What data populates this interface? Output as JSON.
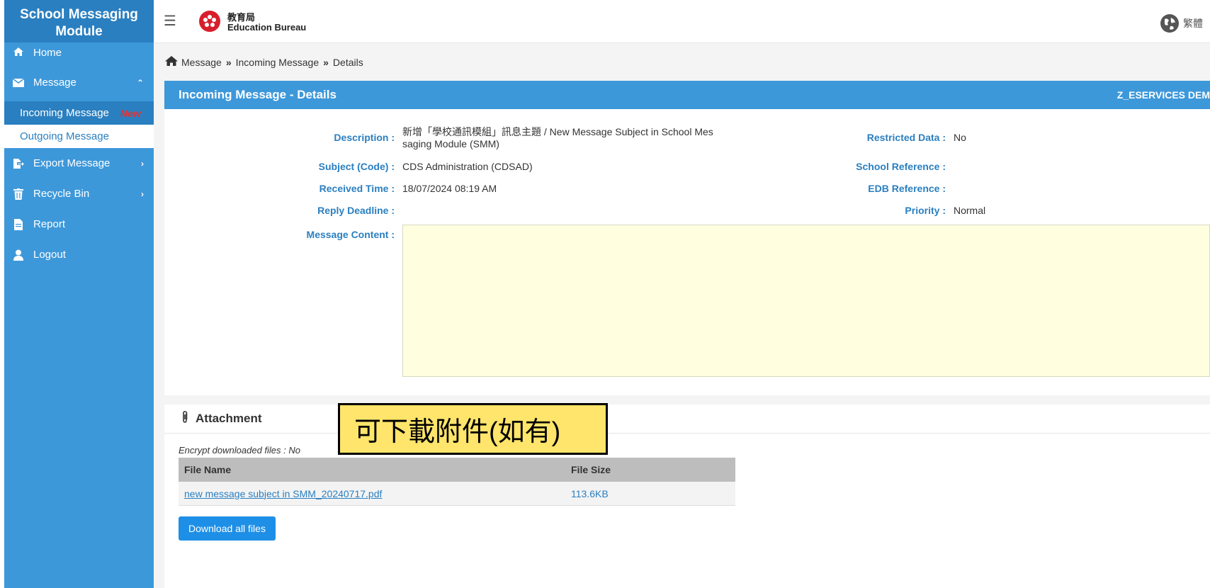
{
  "sidebar": {
    "title_line1": "School Messaging",
    "title_line2": "Module",
    "items": [
      {
        "label": "Home",
        "icon": "home-icon"
      },
      {
        "label": "Message",
        "icon": "envelope-icon"
      },
      {
        "label": "Export Message",
        "icon": "export-icon"
      },
      {
        "label": "Recycle Bin",
        "icon": "trash-icon"
      },
      {
        "label": "Report",
        "icon": "document-icon"
      },
      {
        "label": "Logout",
        "icon": "user-icon"
      }
    ],
    "sub_items": [
      {
        "label": "Incoming Message",
        "badge": "New"
      },
      {
        "label": "Outgoing Message"
      }
    ]
  },
  "topbar": {
    "logo_cn": "教育局",
    "logo_en": "Education Bureau",
    "lang_label": "繁體"
  },
  "breadcrumb": [
    "Message",
    "Incoming Message",
    "Details"
  ],
  "panel": {
    "title": "Incoming Message - Details",
    "right_text": "Z_ESERVICES DEM",
    "fields": {
      "description_label": "Description :",
      "description_line1": "新增「學校通訊模組」訊息主題 / New Message Subject in School Mes",
      "description_line2": "saging Module (SMM)",
      "subject_label": "Subject (Code) :",
      "subject_value": "CDS Administration (CDSAD)",
      "received_label": "Received Time :",
      "received_value": "18/07/2024 08:19 AM",
      "deadline_label": "Reply Deadline :",
      "content_label": "Message Content :",
      "restricted_label": "Restricted Data :",
      "restricted_value": "No",
      "school_ref_label": "School Reference :",
      "edb_ref_label": "EDB Reference :",
      "priority_label": "Priority :",
      "priority_value": "Normal"
    }
  },
  "attachment": {
    "title": "Attachment",
    "encrypt_text": "Encrypt downloaded files : No",
    "columns": [
      "File Name",
      "File Size"
    ],
    "files": [
      {
        "name": "new message subject in SMM_20240717.pdf",
        "size": "113.6KB"
      }
    ],
    "download_label": "Download all files"
  },
  "callout_text": "可下載附件(如有)",
  "colors": {
    "primary": "#3d98da",
    "primary_dark": "#2a7fc0",
    "new_badge": "#e8302f",
    "callout": "#ffe56b"
  }
}
